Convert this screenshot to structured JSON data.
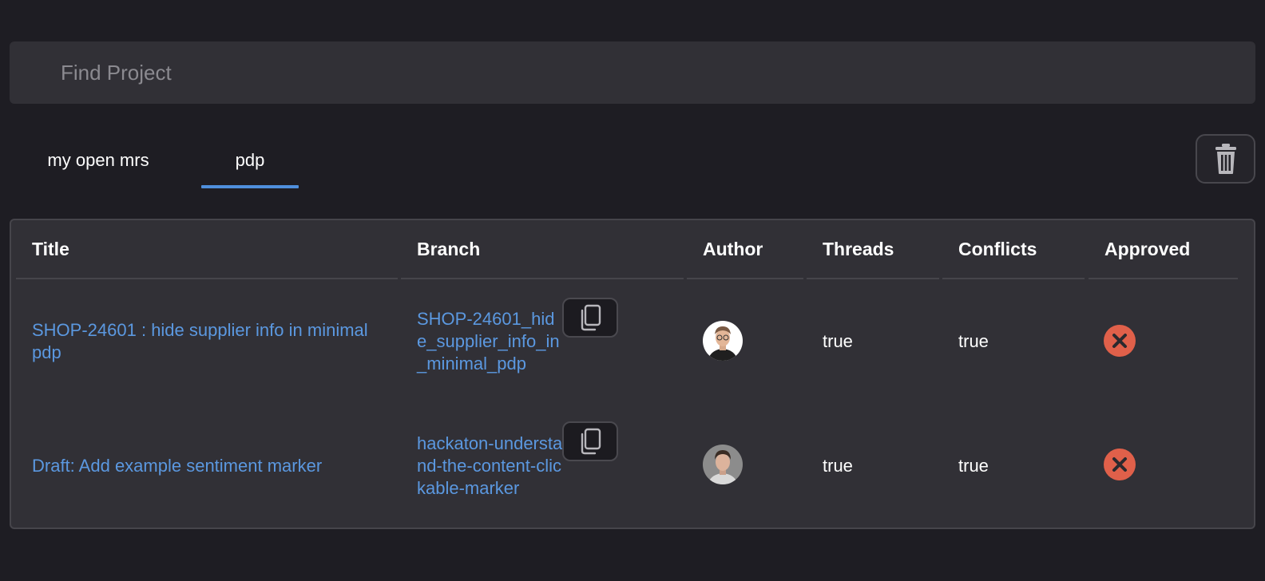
{
  "search": {
    "placeholder": "Find Project",
    "value": ""
  },
  "tabs": [
    {
      "label": "my open mrs",
      "active": false
    },
    {
      "label": "pdp",
      "active": true
    }
  ],
  "toolbar": {
    "delete_icon": "trash-icon"
  },
  "table": {
    "columns": [
      "Title",
      "Branch",
      "Author",
      "Threads",
      "Conflicts",
      "Approved"
    ],
    "rows": [
      {
        "title": "SHOP-24601 : hide supplier info in minimal pdp",
        "branch": "SHOP-24601_hide_supplier_info_in_minimal_pdp",
        "author_icon": "avatar",
        "threads": "true",
        "conflicts": "true",
        "approved_icon": "x-circle-icon"
      },
      {
        "title": "Draft: Add example sentiment marker",
        "branch": "hackaton-understand-the-content-clickable-marker",
        "author_icon": "avatar",
        "threads": "true",
        "conflicts": "true",
        "approved_icon": "x-circle-icon"
      }
    ]
  },
  "colors": {
    "background": "#1e1d23",
    "surface": "#313036",
    "accent": "#4f8fdc",
    "link": "#5b98e0",
    "rejected": "#e0604a"
  }
}
